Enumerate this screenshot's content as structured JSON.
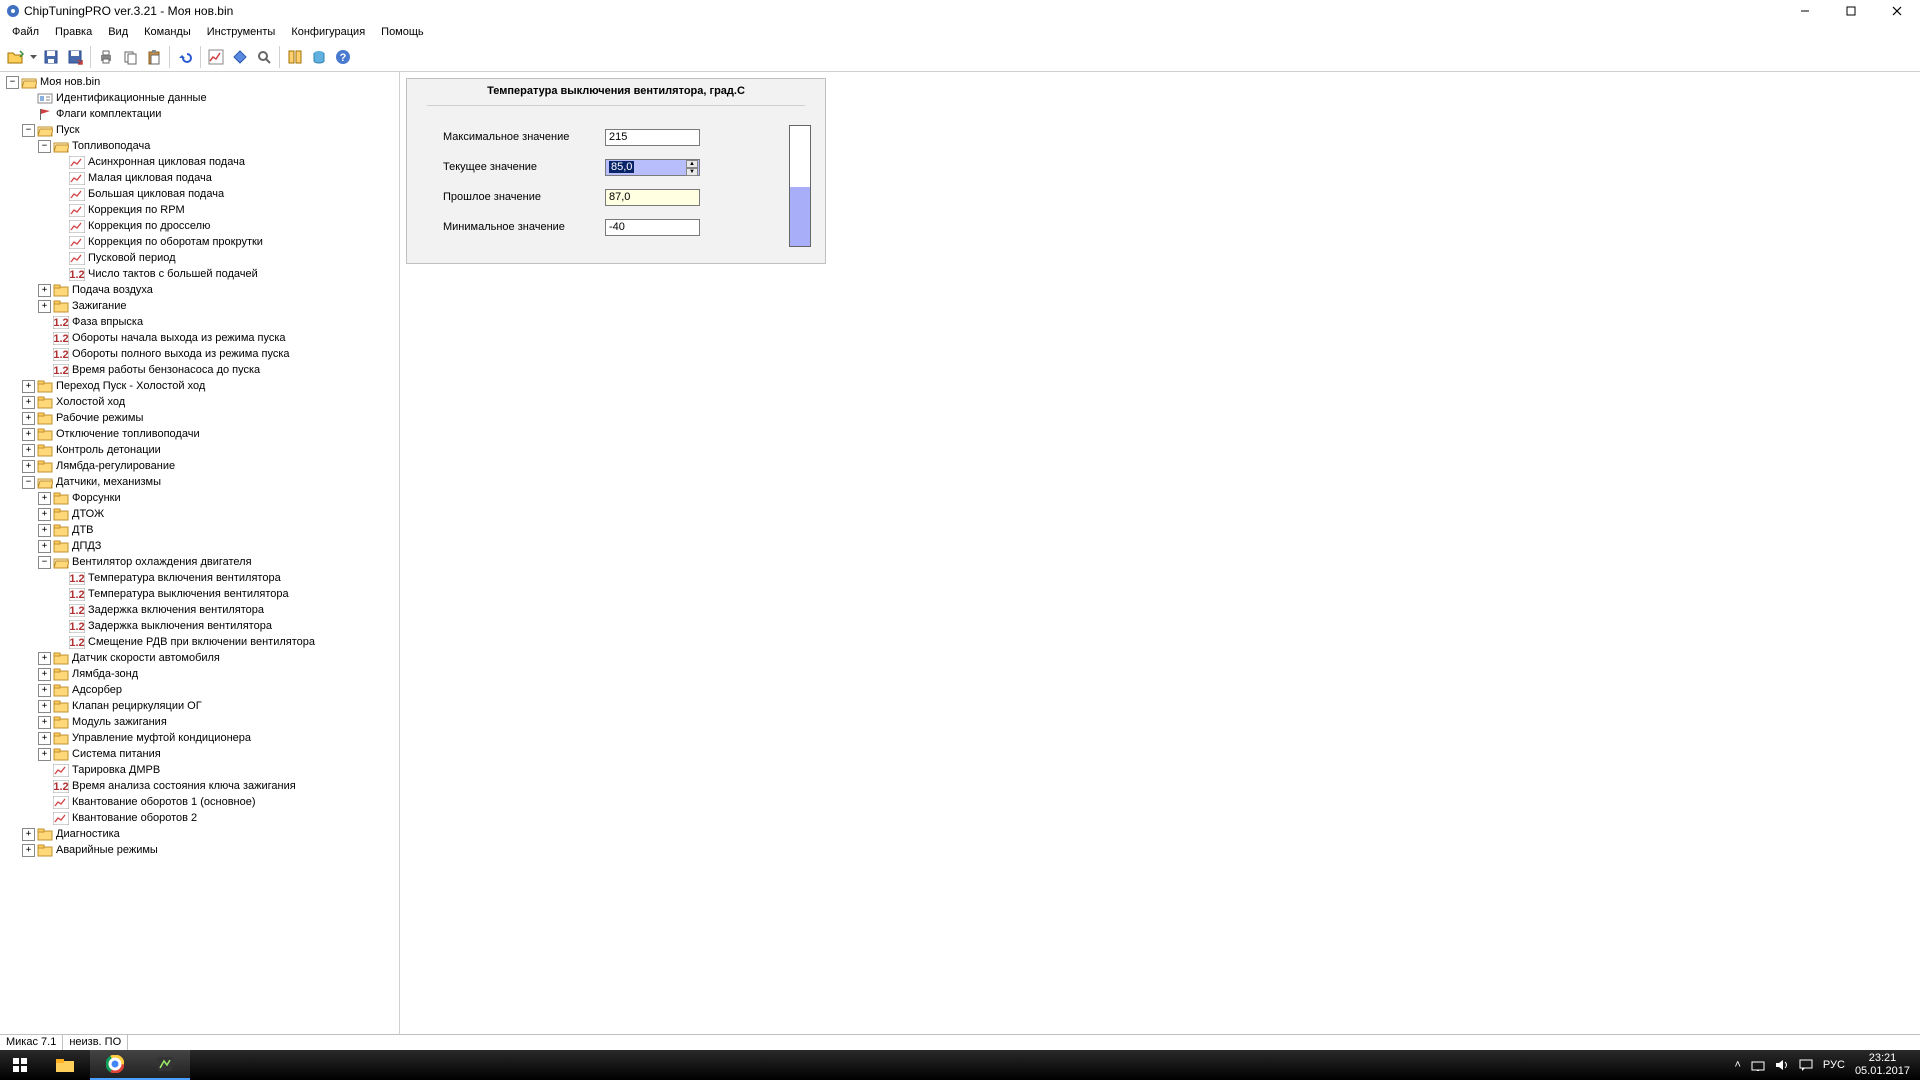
{
  "title": "ChipTuningPRO ver.3.21 - Моя нов.bin",
  "menu": [
    "Файл",
    "Правка",
    "Вид",
    "Команды",
    "Инструменты",
    "Конфигурация",
    "Помощь"
  ],
  "toolbar_icons": [
    "open",
    "save",
    "saveas",
    "print",
    "copy",
    "paste",
    "undo",
    "graph",
    "diamond",
    "search",
    "compare",
    "db",
    "help"
  ],
  "tree": [
    {
      "d": 0,
      "e": "-",
      "k": "folder-open",
      "t": "Моя нов.bin"
    },
    {
      "d": 1,
      "e": "",
      "k": "card",
      "t": "Идентификационные данные"
    },
    {
      "d": 1,
      "e": "",
      "k": "flag",
      "t": "Флаги комплектации"
    },
    {
      "d": 1,
      "e": "-",
      "k": "folder-open",
      "t": "Пуск"
    },
    {
      "d": 2,
      "e": "-",
      "k": "folder-open",
      "t": "Топливоподача"
    },
    {
      "d": 3,
      "e": "",
      "k": "graph",
      "t": "Асинхронная цикловая подача"
    },
    {
      "d": 3,
      "e": "",
      "k": "graph",
      "t": "Малая цикловая подача"
    },
    {
      "d": 3,
      "e": "",
      "k": "graph",
      "t": "Большая цикловая подача"
    },
    {
      "d": 3,
      "e": "",
      "k": "graph",
      "t": "Коррекция по RPM"
    },
    {
      "d": 3,
      "e": "",
      "k": "graph",
      "t": "Коррекция по дросселю"
    },
    {
      "d": 3,
      "e": "",
      "k": "graph",
      "t": "Коррекция по оборотам прокрутки"
    },
    {
      "d": 3,
      "e": "",
      "k": "graph",
      "t": "Пусковой период"
    },
    {
      "d": 3,
      "e": "",
      "k": "num",
      "t": "Число тактов с большей подачей"
    },
    {
      "d": 2,
      "e": "+",
      "k": "folder",
      "t": "Подача воздуха"
    },
    {
      "d": 2,
      "e": "+",
      "k": "folder",
      "t": "Зажигание"
    },
    {
      "d": 2,
      "e": "",
      "k": "num",
      "t": "Фаза впрыска"
    },
    {
      "d": 2,
      "e": "",
      "k": "num",
      "t": "Обороты начала выхода из режима пуска"
    },
    {
      "d": 2,
      "e": "",
      "k": "num",
      "t": "Обороты полного выхода из режима пуска"
    },
    {
      "d": 2,
      "e": "",
      "k": "num",
      "t": "Время работы бензонасоса до пуска"
    },
    {
      "d": 1,
      "e": "+",
      "k": "folder",
      "t": "Переход Пуск - Холостой ход"
    },
    {
      "d": 1,
      "e": "+",
      "k": "folder",
      "t": "Холостой ход"
    },
    {
      "d": 1,
      "e": "+",
      "k": "folder",
      "t": "Рабочие режимы"
    },
    {
      "d": 1,
      "e": "+",
      "k": "folder",
      "t": "Отключение топливоподачи"
    },
    {
      "d": 1,
      "e": "+",
      "k": "folder",
      "t": "Контроль детонации"
    },
    {
      "d": 1,
      "e": "+",
      "k": "folder",
      "t": "Лямбда-регулирование"
    },
    {
      "d": 1,
      "e": "-",
      "k": "folder-open",
      "t": "Датчики, механизмы"
    },
    {
      "d": 2,
      "e": "+",
      "k": "folder",
      "t": "Форсунки"
    },
    {
      "d": 2,
      "e": "+",
      "k": "folder",
      "t": "ДТОЖ"
    },
    {
      "d": 2,
      "e": "+",
      "k": "folder",
      "t": "ДТВ"
    },
    {
      "d": 2,
      "e": "+",
      "k": "folder",
      "t": "ДПДЗ"
    },
    {
      "d": 2,
      "e": "-",
      "k": "folder-open",
      "t": "Вентилятор охлаждения двигателя"
    },
    {
      "d": 3,
      "e": "",
      "k": "num",
      "t": "Температура включения вентилятора"
    },
    {
      "d": 3,
      "e": "",
      "k": "num",
      "t": "Температура выключения вентилятора"
    },
    {
      "d": 3,
      "e": "",
      "k": "num",
      "t": "Задержка включения вентилятора"
    },
    {
      "d": 3,
      "e": "",
      "k": "num",
      "t": "Задержка выключения вентилятора"
    },
    {
      "d": 3,
      "e": "",
      "k": "num",
      "t": "Смещение РДВ при включении вентилятора"
    },
    {
      "d": 2,
      "e": "+",
      "k": "folder",
      "t": "Датчик скорости автомобиля"
    },
    {
      "d": 2,
      "e": "+",
      "k": "folder",
      "t": "Лямбда-зонд"
    },
    {
      "d": 2,
      "e": "+",
      "k": "folder",
      "t": "Адсорбер"
    },
    {
      "d": 2,
      "e": "+",
      "k": "folder",
      "t": "Клапан рециркуляции ОГ"
    },
    {
      "d": 2,
      "e": "+",
      "k": "folder",
      "t": "Модуль зажигания"
    },
    {
      "d": 2,
      "e": "+",
      "k": "folder",
      "t": "Управление муфтой кондиционера"
    },
    {
      "d": 2,
      "e": "+",
      "k": "folder",
      "t": "Система питания"
    },
    {
      "d": 2,
      "e": "",
      "k": "graph",
      "t": "Тарировка ДМРВ"
    },
    {
      "d": 2,
      "e": "",
      "k": "num",
      "t": "Время анализа состояния ключа зажигания"
    },
    {
      "d": 2,
      "e": "",
      "k": "graph",
      "t": "Квантование оборотов 1 (основное)"
    },
    {
      "d": 2,
      "e": "",
      "k": "graph",
      "t": "Квантование оборотов 2"
    },
    {
      "d": 1,
      "e": "+",
      "k": "folder",
      "t": "Диагностика"
    },
    {
      "d": 1,
      "e": "+",
      "k": "folder",
      "t": "Аварийные режимы"
    }
  ],
  "panel": {
    "title": "Температура выключения вентилятора, град.С",
    "max_label": "Максимальное значение",
    "max_value": "215",
    "cur_label": "Текущее значение",
    "cur_value": "85,0",
    "prev_label": "Прошлое значение",
    "prev_value": "87,0",
    "min_label": "Минимальное значение",
    "min_value": "-40",
    "gauge_pct": 49
  },
  "status": {
    "left": "Микас 7.1",
    "right": "неизв. ПО"
  },
  "tray": {
    "lang": "РУС",
    "time": "23:21",
    "date": "05.01.2017"
  }
}
